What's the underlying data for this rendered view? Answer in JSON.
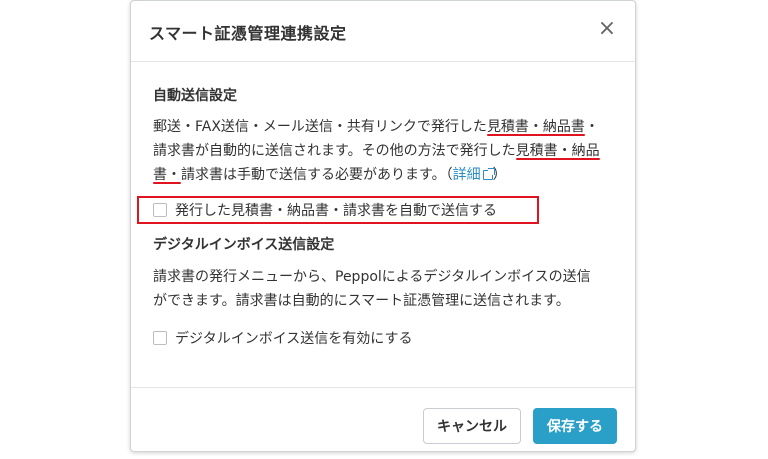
{
  "dialog": {
    "title": "スマート証憑管理連携設定",
    "close_symbol": "×"
  },
  "auto_send": {
    "heading": "自動送信設定",
    "para": {
      "l1_a": "郵送・FAX送信・メール送信・共有リンクで発行した",
      "l1_u": "見積書・納品書",
      "l1_b": "・",
      "l2_a": "請求書が自動的に送信されます。その他の方法で発行した",
      "l2_u": "見積書・納品",
      "l3_u": "書・",
      "l3_a": "請求書は手動で送信する必要があります。（",
      "link": "詳細",
      "l3_end": "）"
    },
    "checkbox_label": "発行した見積書・納品書・請求書を自動で送信する"
  },
  "digital_invoice": {
    "heading": "デジタルインボイス送信設定",
    "para_l1": "請求書の発行メニューから、Peppolによるデジタルインボイスの送信",
    "para_l2": "ができます。請求書は自動的にスマート証憑管理に送信されます。",
    "checkbox_label": "デジタルインボイス送信を有効にする"
  },
  "footer": {
    "cancel_label": "キャンセル",
    "save_label": "保存する"
  },
  "colors": {
    "accent": "#2a9fc8",
    "link": "#2a8ec6",
    "annotation_red": "#e0141e"
  }
}
